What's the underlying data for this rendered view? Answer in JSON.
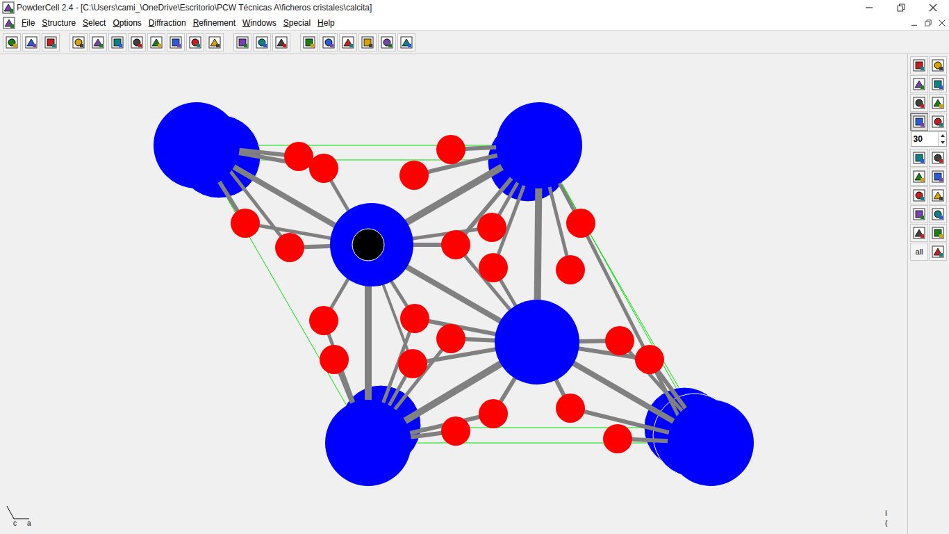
{
  "window": {
    "title": "PowderCell 2.4 - [C:\\Users\\cami_\\OneDrive\\Escritorio\\PCW Técnicas A\\ficheros cristales\\calcita]"
  },
  "menu": [
    "File",
    "Structure",
    "Select",
    "Options",
    "Diffraction",
    "Refinement",
    "Windows",
    "Special",
    "Help"
  ],
  "side_toolbar": {
    "buttons": [
      {
        "pressed": false
      },
      {
        "pressed": false
      },
      {
        "pressed": false
      },
      {
        "pressed": false
      },
      {
        "pressed": false
      },
      {
        "pressed": false
      },
      {
        "pressed": true
      },
      {
        "pressed": false
      }
    ],
    "spin_value": "30",
    "lower_buttons": [
      {
        "kind": "icon"
      },
      {
        "kind": "icon"
      },
      {
        "kind": "icon"
      },
      {
        "kind": "icon"
      },
      {
        "kind": "icon"
      },
      {
        "kind": "icon"
      },
      {
        "kind": "icon"
      },
      {
        "kind": "icon"
      },
      {
        "kind": "icon"
      },
      {
        "kind": "icon"
      },
      {
        "kind": "text",
        "label": "all"
      },
      {
        "kind": "icon"
      }
    ]
  },
  "axes": {
    "labels": [
      "c",
      "a"
    ]
  },
  "status_marks": [
    "I",
    "("
  ],
  "structure": {
    "species": [
      {
        "color": "#0000ff"
      },
      {
        "color": "#ff0000"
      },
      {
        "color": "#000000"
      }
    ]
  }
}
